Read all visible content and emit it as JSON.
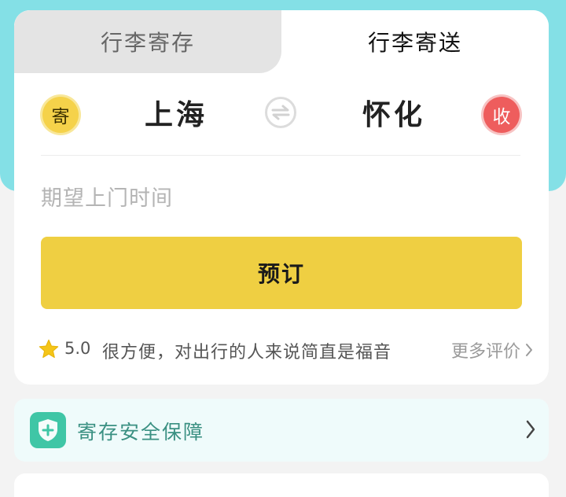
{
  "tabs": [
    {
      "label": "行李寄存",
      "active": false
    },
    {
      "label": "行李寄送",
      "active": true
    }
  ],
  "route": {
    "send_badge": "寄",
    "from_city": "上海",
    "to_city": "怀化",
    "recv_badge": "收",
    "swap_icon": "swap-arrows-icon"
  },
  "time": {
    "placeholder": "期望上门时间"
  },
  "book_button": {
    "label": "预订"
  },
  "review": {
    "rating": "5.0",
    "text": "很方便，对出行的人来说简直是福音",
    "more_label": "更多评价"
  },
  "guarantee": {
    "label": "寄存安全保障",
    "icon": "shield-plus-icon"
  },
  "colors": {
    "header_bg": "#84e0e6",
    "accent_yellow": "#efcf42",
    "receive_red": "#ee5d5d",
    "guarantee_green": "#3fc6a6"
  }
}
